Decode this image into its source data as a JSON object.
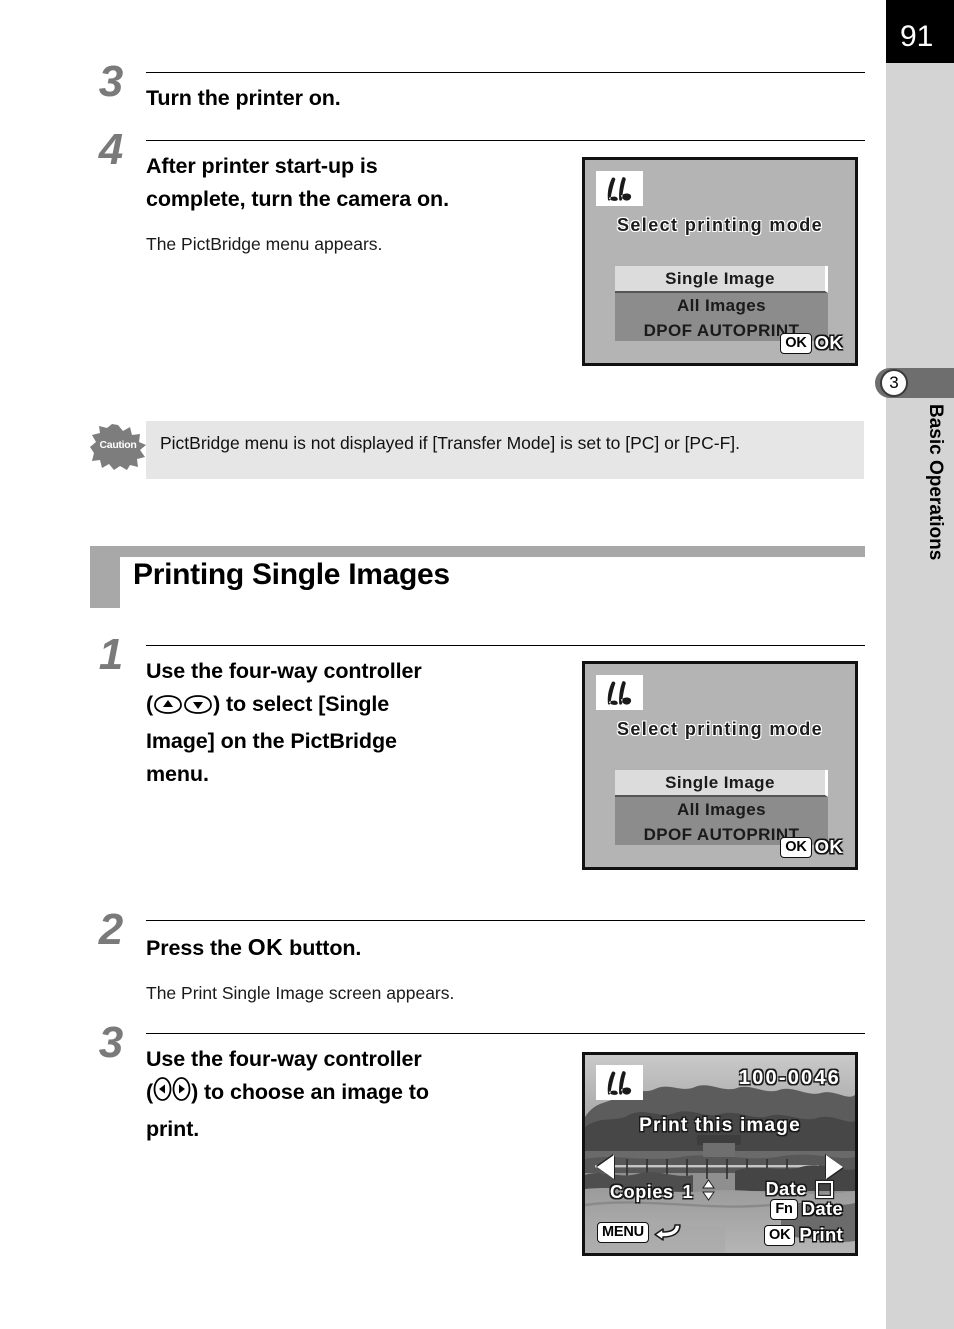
{
  "page": {
    "number": "91",
    "chapter_number": "3",
    "chapter_title": "Basic Operations"
  },
  "steps": [
    {
      "number": "3",
      "title": "Turn the printer on.",
      "description": ""
    },
    {
      "number": "4",
      "title_line1": "After printer start-up is",
      "title_line2": "complete, turn the camera on.",
      "description": "The PictBridge menu appears."
    },
    {
      "number": "1",
      "title_line1": "Use the four-way controller",
      "title_prefix2": "(",
      "title_suffix2": ") to select [Single",
      "title_line3": "Image] on the PictBridge",
      "title_line4": "menu.",
      "description": ""
    },
    {
      "number": "2",
      "title_prefix": "Press the",
      "title_key": "OK",
      "title_suffix": "button.",
      "description": "The Print Single Image screen appears."
    },
    {
      "number": "3",
      "title_line1": "Use the four-way controller",
      "title_prefix2": "(",
      "title_suffix2": ") to choose an image to",
      "title_line3": "print.",
      "description": ""
    }
  ],
  "caution": {
    "badge_label": "Caution",
    "text": "PictBridge menu is not displayed if [Transfer Mode] is set to [PC] or [PC-F]."
  },
  "section": {
    "heading": "Printing Single Images"
  },
  "lcd_menu_screen": {
    "logo_name": "pictbridge-logo",
    "title": "Select printing mode",
    "items": [
      {
        "label": "Single Image",
        "selected": true
      },
      {
        "label": "All Images",
        "selected": false
      },
      {
        "label": "DPOF AUTOPRINT",
        "selected": false
      }
    ],
    "footer_key": "OK",
    "footer_label": "OK"
  },
  "lcd_photo_screen": {
    "logo_name": "pictbridge-logo",
    "file_number": "100-0046",
    "prompt": "Print this image",
    "copies_label": "Copies",
    "copies_value": "1",
    "date_label": "Date",
    "date_checked": false,
    "menu_key": "MENU",
    "keys": [
      {
        "key": "Fn",
        "label": "Date"
      },
      {
        "key": "OK",
        "label": "Print"
      }
    ]
  },
  "colors": {
    "page_block": "#000000",
    "rail": "#d4d4d4",
    "chapter_tab": "#6e6e6e",
    "heading_bar": "#a8a8a8",
    "caution_bg": "#e6e6e6",
    "lcd_bg": "#b4b4b4",
    "lcd_menu_panel": "#8c8c8c",
    "lcd_selected": "#dcdcdc",
    "step_number": "#7a7a7a"
  }
}
